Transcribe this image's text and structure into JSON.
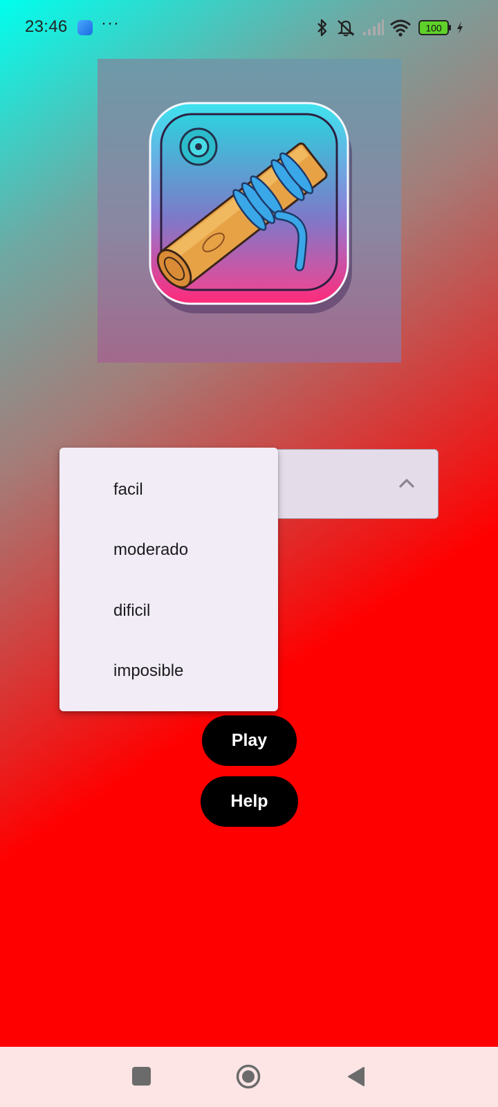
{
  "status_bar": {
    "time": "23:46",
    "more": "···",
    "battery": "100",
    "icons": [
      "bluetooth-icon",
      "silent-icon",
      "signal-icon",
      "wifi-icon",
      "battery-icon",
      "charging-icon"
    ]
  },
  "logo": {
    "icon": "rope-log-knot-icon",
    "colors": {
      "frame_top": "#3ee3ee",
      "frame_bottom": "#ff2a7a",
      "wood": "#e7a246",
      "rope": "#3aa7e8"
    }
  },
  "difficulty_select": {
    "selected": "",
    "expanded": true,
    "options": [
      "facil",
      "moderado",
      "dificil",
      "imposible"
    ]
  },
  "buttons": {
    "play": "Play",
    "help": "Help"
  },
  "nav": {
    "icons": [
      "recents-icon",
      "home-icon",
      "back-icon"
    ]
  },
  "colors": {
    "gradient_start": "#00ffee",
    "gradient_end": "#ff0000",
    "button_bg": "#000000",
    "menu_bg": "#f1ecf5"
  }
}
